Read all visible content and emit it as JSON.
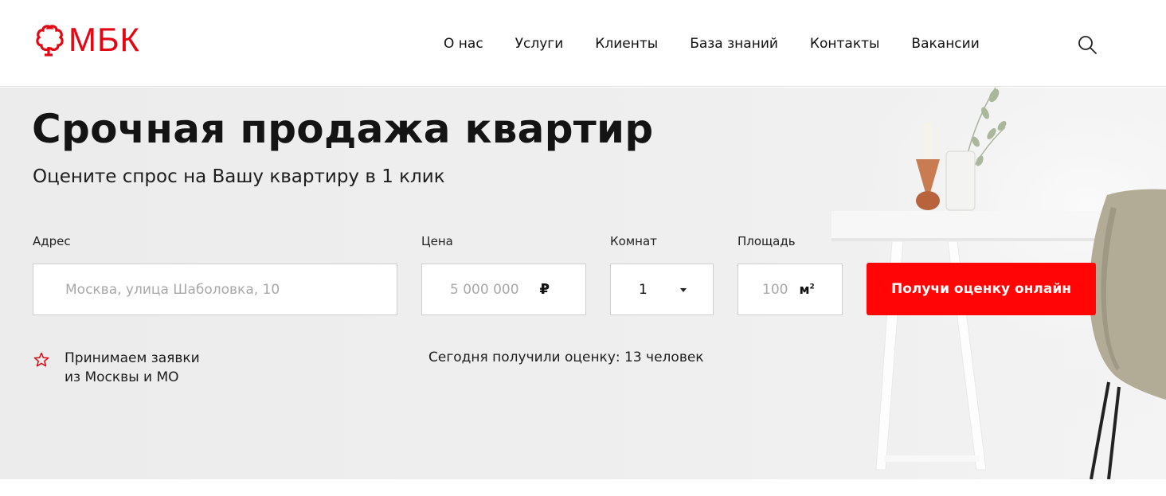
{
  "brand": {
    "name": "МБК",
    "color": "#e30613"
  },
  "nav": [
    {
      "label": "О нас"
    },
    {
      "label": "Услуги"
    },
    {
      "label": "Клиенты"
    },
    {
      "label": "База знаний"
    },
    {
      "label": "Контакты"
    },
    {
      "label": "Вакансии"
    }
  ],
  "header": {
    "search_icon": "search-icon"
  },
  "hero": {
    "title": "Срочная продажа квартир",
    "subtitle": "Оцените спрос на Вашу квартиру в 1 клик"
  },
  "form": {
    "address": {
      "label": "Адрес",
      "placeholder": "Москва, улица Шаболовка, 10"
    },
    "price": {
      "label": "Цена",
      "placeholder": "5 000 000",
      "unit": "₽"
    },
    "rooms": {
      "label": "Комнат",
      "value": "1"
    },
    "area": {
      "label": "Площадь",
      "placeholder": "100",
      "unit": "м",
      "unit_sup": "2"
    },
    "submit_label": "Получи оценку онлайн",
    "accent_color": "#ff0505"
  },
  "info": {
    "region_line1": "Принимаем заявки",
    "region_line2": "из Москвы и МО",
    "counter": "Сегодня получили оценку: 13 человек"
  }
}
